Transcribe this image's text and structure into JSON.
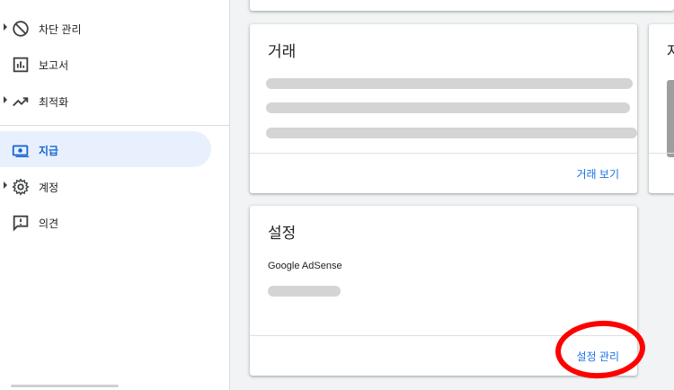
{
  "sidebar": {
    "items": [
      {
        "label": "차단 관리",
        "icon": "block-icon",
        "expandable": true
      },
      {
        "label": "보고서",
        "icon": "bar-chart-icon",
        "expandable": false
      },
      {
        "label": "최적화",
        "icon": "trending-up-icon",
        "expandable": true
      },
      {
        "label": "지급",
        "icon": "payments-icon",
        "expandable": false,
        "active": true
      },
      {
        "label": "계정",
        "icon": "gear-icon",
        "expandable": true
      },
      {
        "label": "의견",
        "icon": "feedback-icon",
        "expandable": false
      }
    ]
  },
  "transactions_card": {
    "title": "거래",
    "link_label": "거래 보기"
  },
  "settings_card": {
    "title": "설정",
    "product_name": "Google AdSense",
    "link_label": "설정 관리"
  },
  "partial_card": {
    "title_fragment": "자"
  },
  "colors": {
    "accent": "#1a73e8",
    "active_bg": "#e8f0fe",
    "annotation": "#ff0000",
    "skeleton": "#d4d4d4"
  }
}
